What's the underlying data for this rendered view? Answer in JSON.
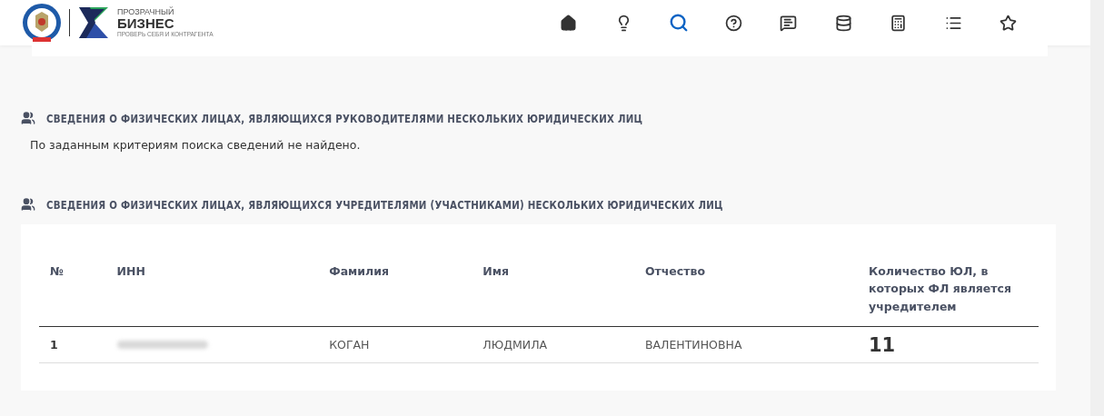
{
  "header": {
    "logo": {
      "title_top": "ПРОЗРАЧНЫЙ",
      "title_main": "БИЗНЕС",
      "tagline": "ПРОВЕРЬ СЕБЯ И КОНТРАГЕНТА"
    },
    "nav": [
      {
        "kind": "home",
        "selected": false
      },
      {
        "kind": "idea",
        "selected": false
      },
      {
        "kind": "search",
        "selected": true
      },
      {
        "kind": "help",
        "selected": false
      },
      {
        "kind": "feedback",
        "selected": false
      },
      {
        "kind": "database",
        "selected": false
      },
      {
        "kind": "calculator",
        "selected": false
      },
      {
        "kind": "list",
        "selected": false
      },
      {
        "kind": "favorites",
        "selected": false
      }
    ]
  },
  "sections": [
    {
      "title": "СВЕДЕНИЯ О ФИЗИЧЕСКИХ ЛИЦАХ, ЯВЛЯЮЩИХСЯ РУКОВОДИТЕЛЯМИ НЕСКОЛЬКИХ ЮРИДИЧЕСКИХ ЛИЦ",
      "message": "По заданным критериям поиска сведений не найдено."
    },
    {
      "title": "СВЕДЕНИЯ О ФИЗИЧЕСКИХ ЛИЦАХ, ЯВЛЯЮЩИХСЯ УЧРЕДИТЕЛЯМИ (УЧАСТНИКАМИ) НЕСКОЛЬКИХ ЮРИДИЧЕСКИХ ЛИЦ",
      "table": {
        "columns": [
          "№",
          "ИНН",
          "Фамилия",
          "Имя",
          "Отчество",
          "Количество ЮЛ, в которых ФЛ является учредителем"
        ],
        "rows": [
          {
            "number": "1",
            "inn_redacted": true,
            "surname": "КОГАН",
            "name": "ЛЮДМИЛА",
            "patronymic": "ВАЛЕНТИНОВНА",
            "count": "11"
          }
        ]
      }
    }
  ]
}
